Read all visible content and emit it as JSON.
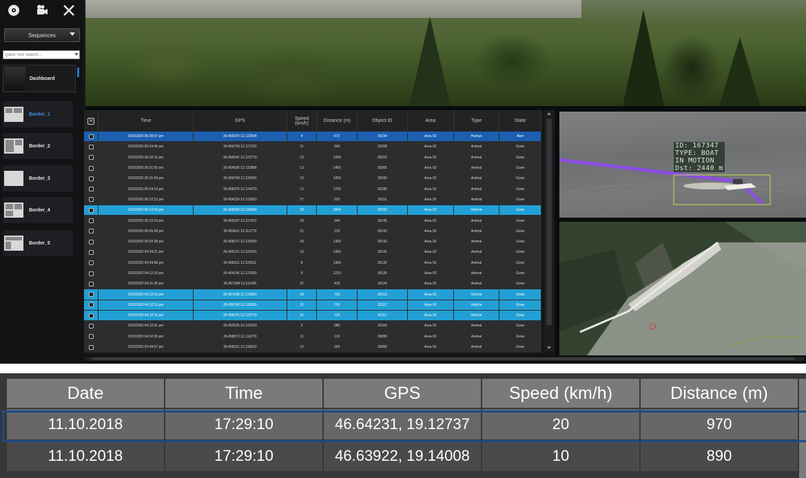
{
  "sidebar": {
    "toolbar": [
      {
        "name": "disc-icon",
        "glyph": "💿"
      },
      {
        "name": "camera-icon",
        "glyph": "🎥"
      },
      {
        "name": "close-icon",
        "glyph": "✕"
      }
    ],
    "sequence_select": "Sequences",
    "search_placeholder": "Quick Text Search...",
    "dashboard_label": "Dashboard",
    "items": [
      {
        "label": "Border_1",
        "active": true
      },
      {
        "label": "Border_2",
        "active": false
      },
      {
        "label": "Border_3",
        "active": false
      },
      {
        "label": "Border_4",
        "active": false
      },
      {
        "label": "Border_5",
        "active": false
      }
    ]
  },
  "table": {
    "columns": [
      "Time",
      "GPS",
      "Speed\n(km/h)",
      "Distance (m)",
      "Object ID",
      "Area",
      "Type",
      "State"
    ],
    "rows": [
      {
        "time": "9/22/2020 05:38:07 pm",
        "gps": "39.456979 12.122504",
        "speed": "4",
        "distance": "672",
        "id": "30234",
        "area": "Area 02",
        "type": "Human",
        "state": "Alert",
        "sel": "dark"
      },
      {
        "time": "9/22/2020 05:34:45 pm",
        "gps": "39.456768 12.117220",
        "speed": "11",
        "distance": "340",
        "id": "30208",
        "area": "Area 02",
        "type": "Animal",
        "state": "Gone",
        "sel": ""
      },
      {
        "time": "9/22/2020 05:32:11 pm",
        "gps": "39.456542 12.123770",
        "speed": "13",
        "distance": "1200",
        "id": "30215",
        "area": "Area 02",
        "type": "Animal",
        "state": "Gone",
        "sel": ""
      },
      {
        "time": "9/22/2020 05:31:55 pm",
        "gps": "39.454938 12.123858",
        "speed": "13",
        "distance": "1450",
        "id": "30205",
        "area": "Area 02",
        "type": "Animal",
        "state": "Gone",
        "sel": ""
      },
      {
        "time": "9/22/2020 05:31:43 pm",
        "gps": "39.456768 12.115060",
        "speed": "10",
        "distance": "1250",
        "id": "30190",
        "area": "Area 02",
        "type": "Animal",
        "state": "Gone",
        "sel": ""
      },
      {
        "time": "9/22/2020 05:24:13 pm",
        "gps": "39.458376 12.124270",
        "speed": "12",
        "distance": "1700",
        "id": "30189",
        "area": "Area 02",
        "type": "Animal",
        "state": "Gone",
        "sel": ""
      },
      {
        "time": "9/22/2020 05:12:22 pm",
        "gps": "39.454218 12.122810",
        "speed": "27",
        "distance": "520",
        "id": "30151",
        "area": "Area 02",
        "type": "Animal",
        "state": "Gone",
        "sel": ""
      },
      {
        "time": "9/22/2020 05:12:20 pm",
        "gps": "39.458168 12.126040",
        "speed": "30",
        "distance": "1840",
        "id": "30150",
        "area": "Area 02",
        "type": "Vehicle",
        "state": "Gone",
        "sel": "light"
      },
      {
        "time": "9/22/2020 05:10:10 pm",
        "gps": "39.455347 12.117421",
        "speed": "18",
        "distance": "340",
        "id": "30145",
        "area": "Area 02",
        "type": "Animal",
        "state": "Gone",
        "sel": ""
      },
      {
        "time": "9/22/2020 05:05:49 pm",
        "gps": "39.453411 12.113773",
        "speed": "21",
        "distance": "210",
        "id": "30143",
        "area": "Area 02",
        "type": "Animal",
        "state": "Gone",
        "sel": ""
      },
      {
        "time": "9/22/2020 05:02:28 pm",
        "gps": "39.458271 12.120650",
        "speed": "20",
        "distance": "1360",
        "id": "30142",
        "area": "Area 02",
        "type": "Animal",
        "state": "Gone",
        "sel": ""
      },
      {
        "time": "9/22/2020 04:34:21 pm",
        "gps": "39.456131 12.120421",
        "speed": "16",
        "distance": "1360",
        "id": "30141",
        "area": "Area 02",
        "type": "Animal",
        "state": "Gone",
        "sel": ""
      },
      {
        "time": "9/22/2020 04:34:58 pm",
        "gps": "39.458211 12.120511",
        "speed": "8",
        "distance": "1360",
        "id": "30132",
        "area": "Area 02",
        "type": "Animal",
        "state": "Gone",
        "sel": ""
      },
      {
        "time": "9/22/2020 04:22:10 pm",
        "gps": "39.454196 12.122560",
        "speed": "5",
        "distance": "1210",
        "id": "30126",
        "area": "Area 02",
        "type": "Animal",
        "state": "Gone",
        "sel": ""
      },
      {
        "time": "9/22/2020 04:21:45 pm",
        "gps": "39.457348 12.111420",
        "speed": "21",
        "distance": "410",
        "id": "30124",
        "area": "Area 02",
        "type": "Animal",
        "state": "Gone",
        "sel": ""
      },
      {
        "time": "9/22/2020 04:12:16 pm",
        "gps": "39.457638 12.123850",
        "speed": "28",
        "distance": "720",
        "id": "30113",
        "area": "Area 02",
        "type": "Vehicle",
        "state": "Gone",
        "sel": "light"
      },
      {
        "time": "9/22/2020 04:12:13 pm",
        "gps": "39.456768 12.125060",
        "speed": "31",
        "distance": "720",
        "id": "30112",
        "area": "Area 02",
        "type": "Vehicle",
        "state": "Gone",
        "sel": "light"
      },
      {
        "time": "9/22/2020 04:12:11 pm",
        "gps": "39.458376 12.123770",
        "speed": "31",
        "distance": "720",
        "id": "30111",
        "area": "Area 02",
        "type": "Vehicle",
        "state": "Gone",
        "sel": "light"
      },
      {
        "time": "9/22/2020 04:12:01 pm",
        "gps": "39.452526 12.122253",
        "speed": "5",
        "distance": "980",
        "id": "30104",
        "area": "Area 02",
        "type": "Animal",
        "state": "Gone",
        "sel": ""
      },
      {
        "time": "9/22/2020 04:02:36 pm",
        "gps": "39.458572 12.112270",
        "speed": "11",
        "distance": "110",
        "id": "30095",
        "area": "Area 02",
        "type": "Animal",
        "state": "Gone",
        "sel": ""
      },
      {
        "time": "9/22/2020 03:49:57 pm",
        "gps": "39.458131 12.116810",
        "speed": "12",
        "distance": "260",
        "id": "30089",
        "area": "Area 02",
        "type": "Animal",
        "state": "Gone",
        "sel": ""
      }
    ]
  },
  "hud": {
    "id_line": "ID: 167347",
    "type_line": "TYPE: BOAT",
    "motion_line": "IN MOTION",
    "dist_line": "Dst: 2440 m"
  },
  "zoom_table": {
    "columns": [
      "Date",
      "Time",
      "GPS",
      "Speed (km/h)",
      "Distance (m)"
    ],
    "rows": [
      [
        "11.10.2018",
        "17:29:10",
        "46.64231, 19.12737",
        "20",
        "970"
      ],
      [
        "11.10.2018",
        "17:29:10",
        "46.63922, 19.14008",
        "10",
        "890"
      ]
    ]
  },
  "colors": {
    "selection_dark": "#1c5fb0",
    "selection_light": "#22a0d6",
    "track_line": "#8a4fe0",
    "bbox": "#c8e04a",
    "zoom_selection_frame": "#1d4c86"
  }
}
